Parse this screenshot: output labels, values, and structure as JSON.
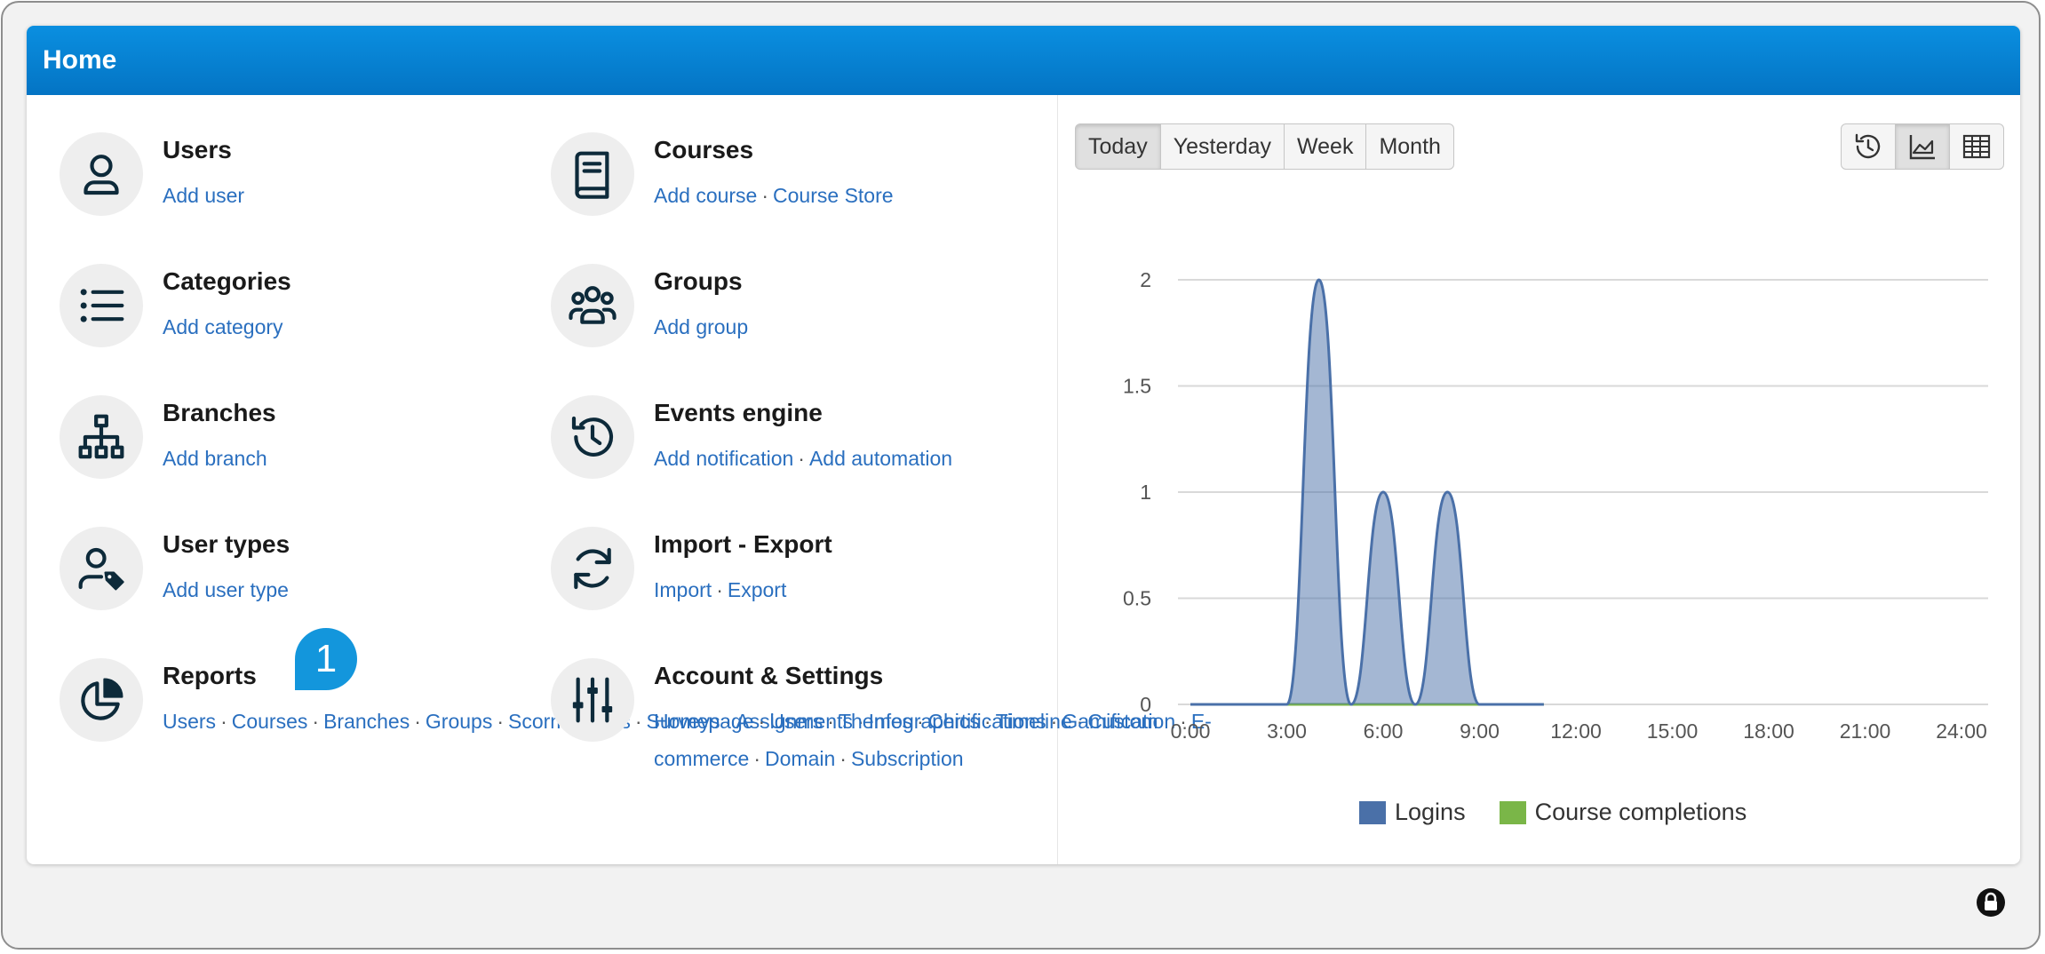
{
  "header": {
    "title": "Home"
  },
  "menu": [
    {
      "key": "users",
      "title": "Users",
      "icon": "user-icon",
      "links": [
        "Add user"
      ]
    },
    {
      "key": "categories",
      "title": "Categories",
      "icon": "list-icon",
      "links": [
        "Add category"
      ]
    },
    {
      "key": "branches",
      "title": "Branches",
      "icon": "sitemap-icon",
      "links": [
        "Add branch"
      ]
    },
    {
      "key": "user-types",
      "title": "User types",
      "icon": "user-tag-icon",
      "links": [
        "Add user type"
      ]
    },
    {
      "key": "reports",
      "title": "Reports",
      "icon": "pie-chart-icon",
      "links": [
        "Users",
        "Courses",
        "Branches",
        "Groups",
        "Scorm",
        "Tests",
        "Surveys",
        "Assignments",
        "Infographics",
        "Timeline",
        "Custom"
      ]
    },
    {
      "key": "courses",
      "title": "Courses",
      "icon": "book-icon",
      "links": [
        "Add course",
        "Course Store"
      ]
    },
    {
      "key": "groups",
      "title": "Groups",
      "icon": "users-group-icon",
      "links": [
        "Add group"
      ]
    },
    {
      "key": "events-engine",
      "title": "Events engine",
      "icon": "history-icon",
      "links": [
        "Add notification",
        "Add automation"
      ]
    },
    {
      "key": "import-export",
      "title": "Import - Export",
      "icon": "sync-icon",
      "links": [
        "Import",
        "Export"
      ]
    },
    {
      "key": "account-settings",
      "title": "Account & Settings",
      "icon": "sliders-icon",
      "links": [
        "Homepage",
        "Users",
        "Themes",
        "Certifications",
        "Gamification",
        "E-commerce",
        "Domain",
        "Subscription"
      ]
    }
  ],
  "tooltip_marker": "1",
  "period_buttons": [
    "Today",
    "Yesterday",
    "Week",
    "Month"
  ],
  "active_period": "Today",
  "view_buttons": [
    "history-icon",
    "area-chart-icon",
    "table-icon"
  ],
  "active_view": "area-chart-icon",
  "chart_data": {
    "type": "area",
    "x": [
      "0:00",
      "1:00",
      "2:00",
      "3:00",
      "4:00",
      "5:00",
      "6:00",
      "7:00",
      "8:00",
      "9:00",
      "10:00",
      "11:00"
    ],
    "x_ticks": [
      "0:00",
      "3:00",
      "6:00",
      "9:00",
      "12:00",
      "15:00",
      "18:00",
      "21:00",
      "24:00"
    ],
    "y_ticks": [
      "0",
      "0.5",
      "1",
      "1.5",
      "2"
    ],
    "ylim": [
      0,
      2
    ],
    "xlim": [
      0,
      24
    ],
    "grid": true,
    "legend": "bottom",
    "series": [
      {
        "name": "Logins",
        "color": "#4a70a8",
        "values": [
          0,
          0,
          0,
          0,
          2,
          0,
          1,
          0,
          1,
          0,
          0,
          0
        ]
      },
      {
        "name": "Course completions",
        "color": "#7ab648",
        "values": [
          0,
          0,
          0,
          0,
          0,
          0,
          0,
          0,
          0,
          0,
          0,
          0
        ]
      }
    ]
  },
  "colors": {
    "header": "#0a85d6",
    "link": "#2a6fbf",
    "tooltip": "#1396dc"
  }
}
